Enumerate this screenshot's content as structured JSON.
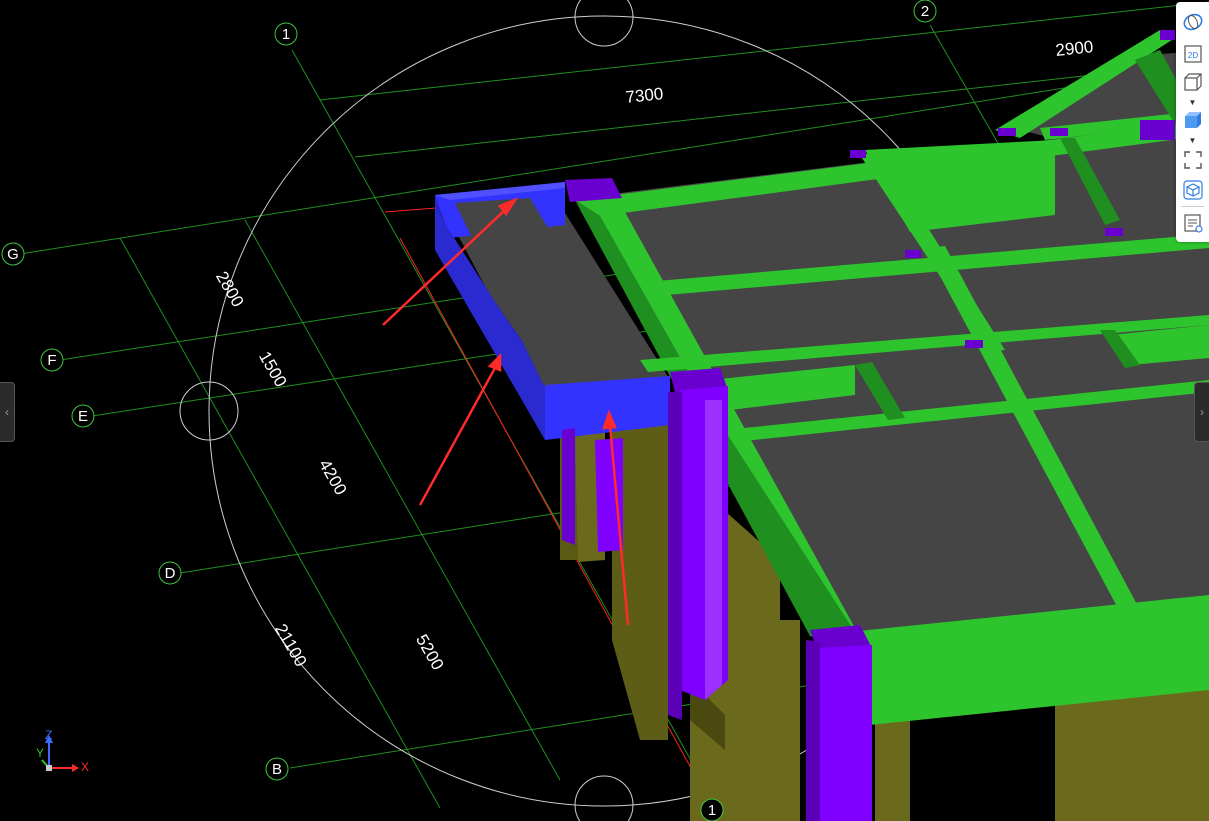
{
  "grid": {
    "vertical_axes": [
      "1",
      "2"
    ],
    "horizontal_axes": [
      "G",
      "F",
      "E",
      "D",
      "B"
    ],
    "bottom_axis": "1"
  },
  "dimensions": {
    "top_span": "7300",
    "top_right_span": "2900",
    "left_g_f": "2800",
    "left_f_e": "1500",
    "left_e_d": "4200",
    "left_d_b": "5200",
    "left_total": "21100"
  },
  "toolbar": {
    "items": [
      {
        "name": "orbit",
        "icon": "orbit-icon"
      },
      {
        "name": "2d",
        "icon": "view-2d-icon",
        "label": "2D"
      },
      {
        "name": "wireframe-cube",
        "icon": "wireframe-cube-icon"
      },
      {
        "name": "solid-cube",
        "icon": "solid-cube-icon"
      },
      {
        "name": "fit-view",
        "icon": "fit-view-icon"
      },
      {
        "name": "view-cube",
        "icon": "view-cube-icon"
      },
      {
        "name": "properties",
        "icon": "properties-list-icon"
      }
    ]
  },
  "axis_triad": {
    "x": "X",
    "y": "Y",
    "z": "Z"
  },
  "colors": {
    "background": "#000000",
    "grid_line": "#1f8f1f",
    "slab": "#454545",
    "beam_green": "#2ec42e",
    "beam_green_dark": "#1f8f1f",
    "highlight_beam": "#3333ff",
    "column_purple": "#8000ff",
    "wall_olive": "#6b6a1c",
    "annotation_arrow": "#ff2a2a",
    "yellow_patch": "#ffff33"
  }
}
